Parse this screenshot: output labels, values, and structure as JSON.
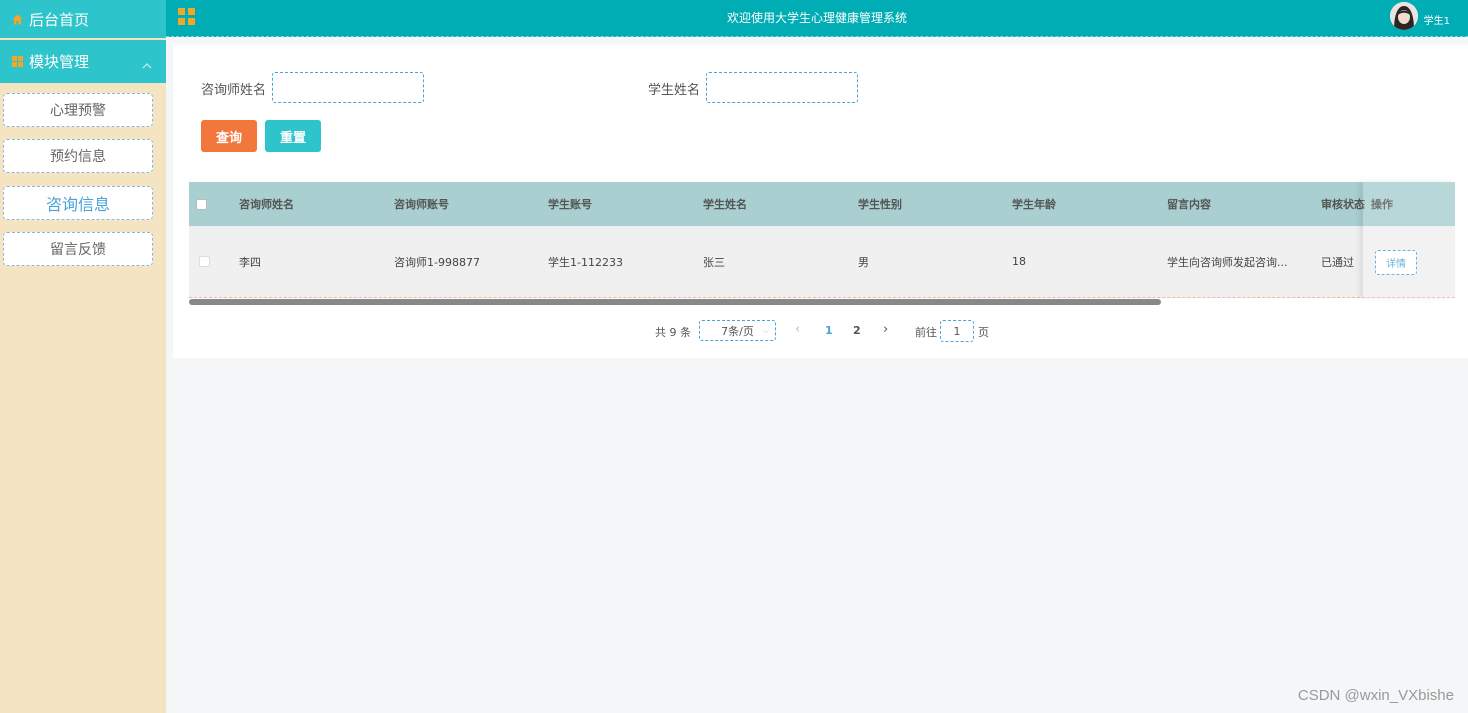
{
  "sidebar": {
    "home_label": "后台首页",
    "module_label": "模块管理",
    "items": [
      {
        "label": "心理预警"
      },
      {
        "label": "预约信息"
      },
      {
        "label": "咨询信息"
      },
      {
        "label": "留言反馈"
      }
    ]
  },
  "header": {
    "title": "欢迎使用大学生心理健康管理系统",
    "user": "学生1"
  },
  "search": {
    "counselor_label": "咨询师姓名",
    "counselor_value": "",
    "student_label": "学生姓名",
    "student_value": "",
    "query_button": "查询",
    "reset_button": "重置"
  },
  "table": {
    "columns": [
      "咨询师姓名",
      "咨询师账号",
      "学生账号",
      "学生姓名",
      "学生性别",
      "学生年龄",
      "留言内容",
      "审核状态",
      "操作"
    ],
    "rows": [
      [
        "李四",
        "咨询师1-998877",
        "学生1-112233",
        "张三",
        "男",
        "18",
        "学生向咨询师发起咨询...",
        "已通过",
        "详情"
      ]
    ]
  },
  "pagination": {
    "total": "共 9 条",
    "page_size": "7条/页",
    "prev": "‹",
    "pages": [
      "1",
      "2"
    ],
    "next": "›",
    "goto_prefix": "前往",
    "goto_value": "1",
    "goto_suffix": "页"
  },
  "watermark": "CSDN @wxin_VXbishe",
  "colors": {
    "header": "#00adb5",
    "sidebar_bg": "#f4e4c2",
    "sidebar_accent": "#2ec4cc",
    "query_button": "#f1773c",
    "reset_button": "#2ec4cc",
    "table_header": "#a9cfd1"
  }
}
